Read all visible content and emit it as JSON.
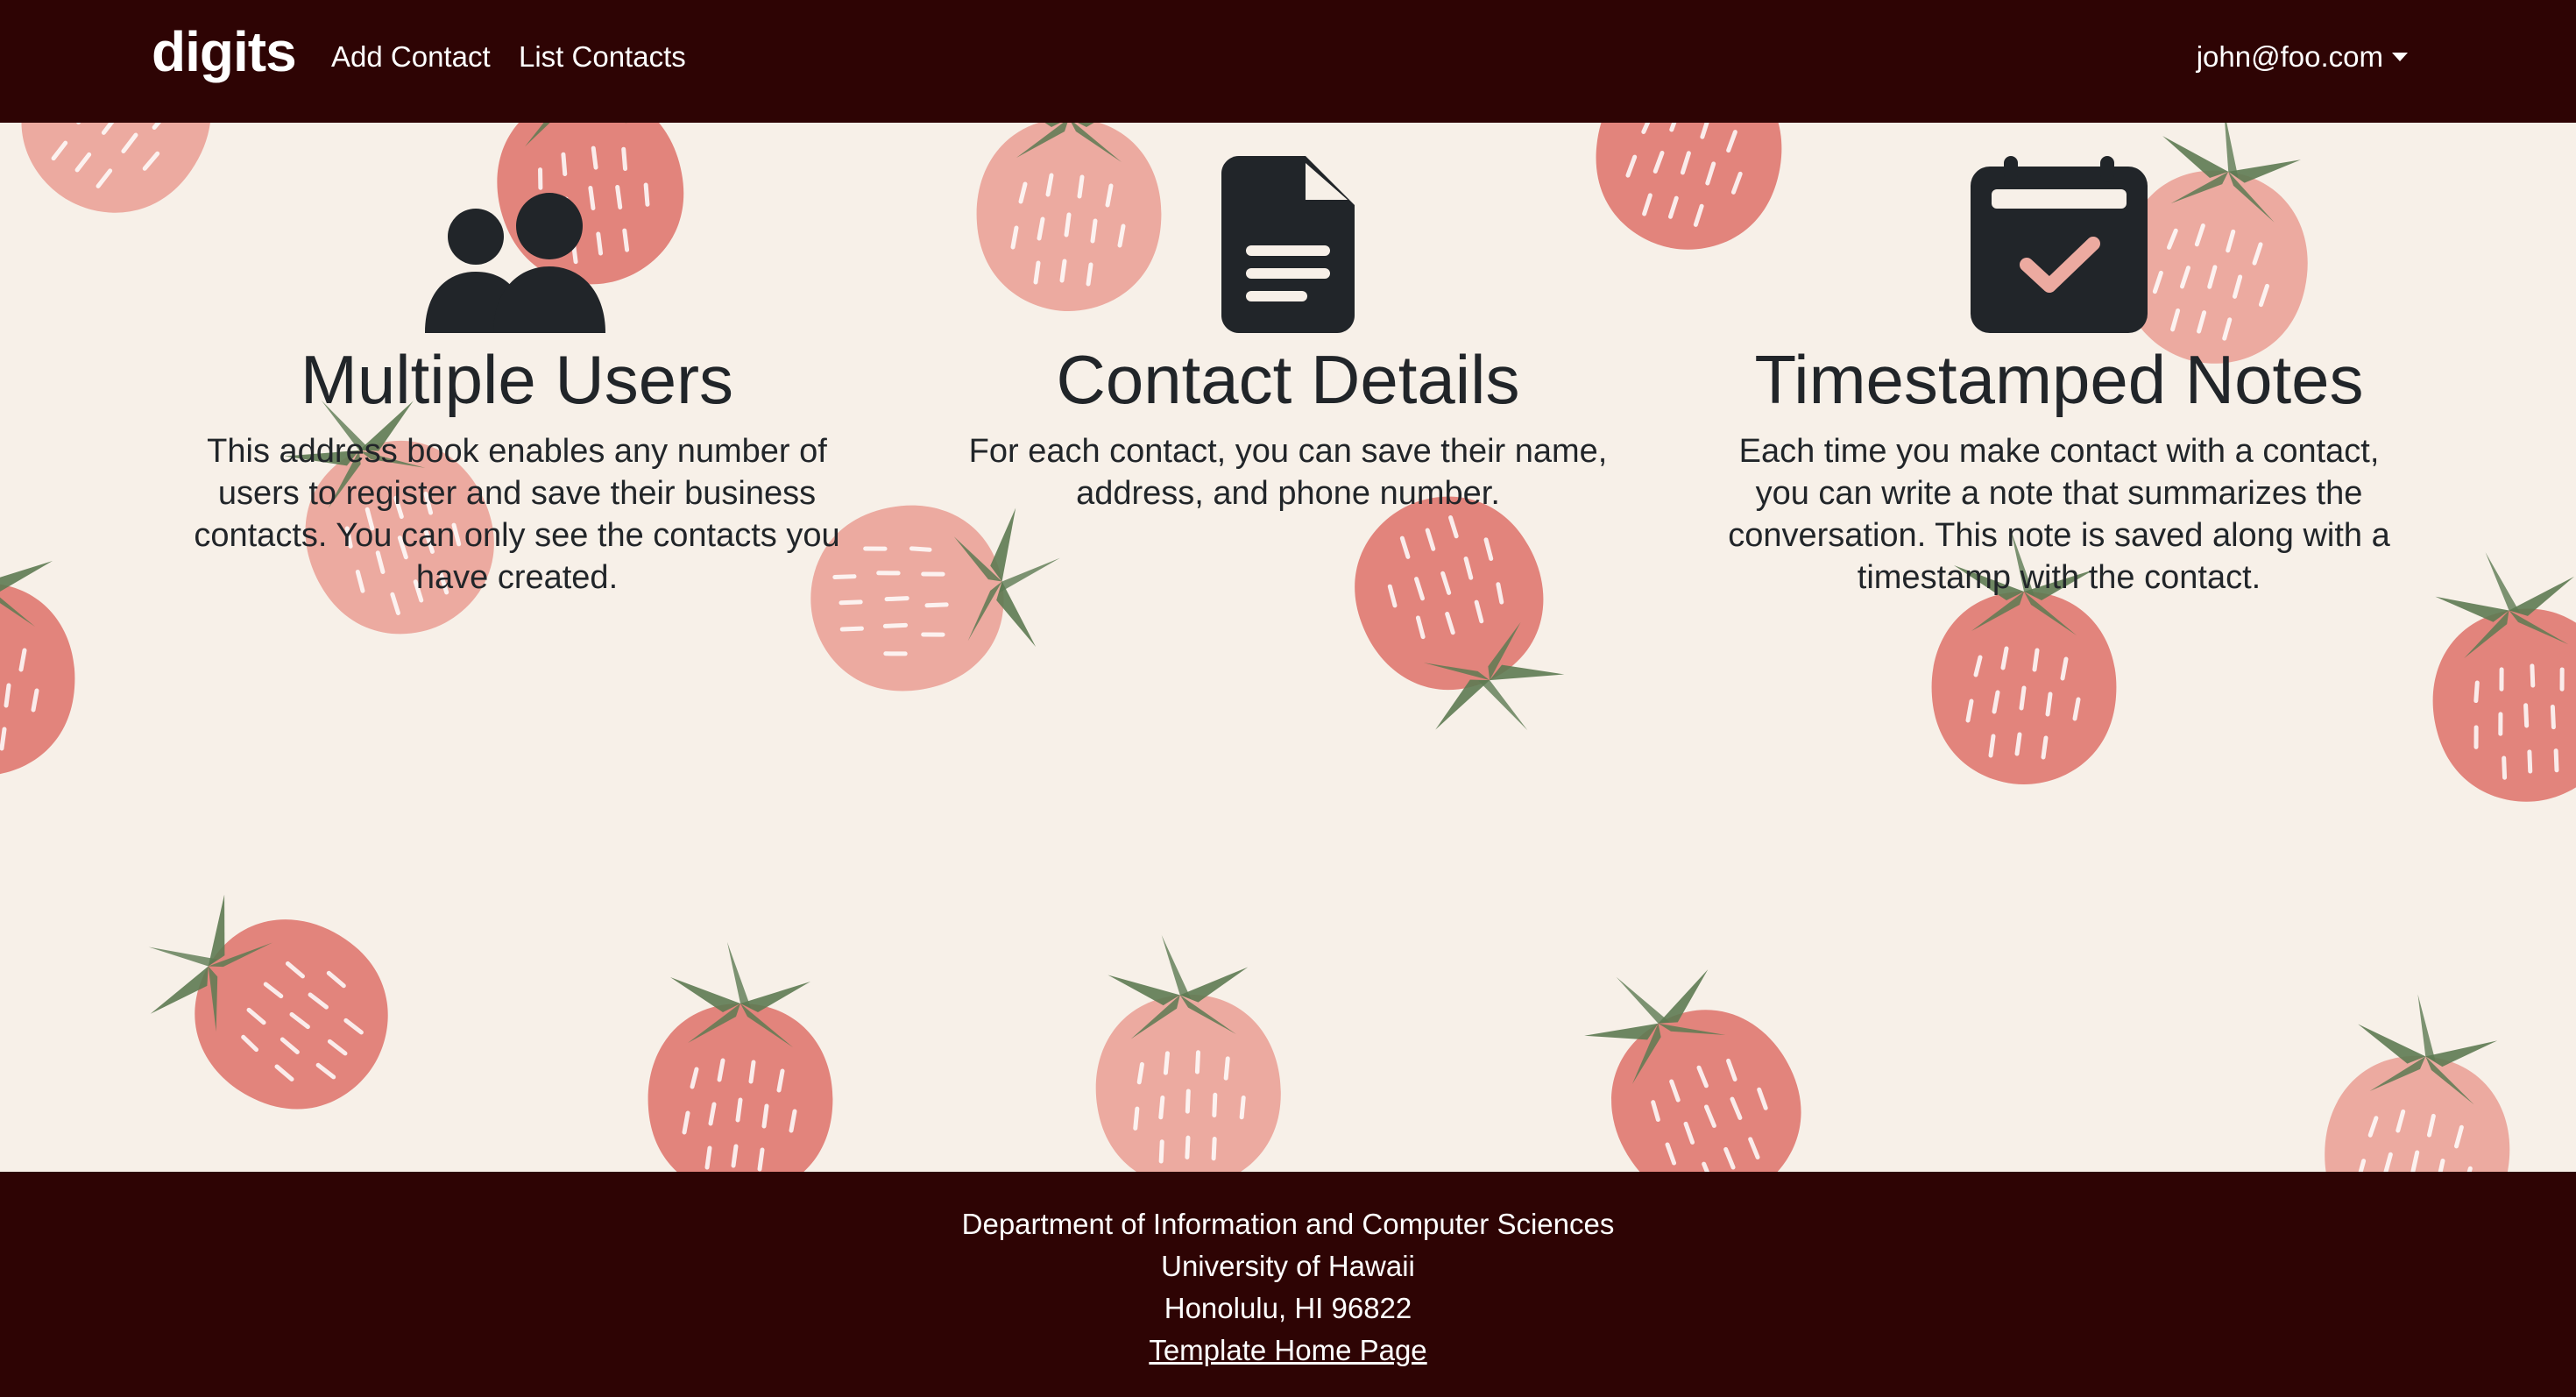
{
  "nav": {
    "brand": "digits",
    "links": [
      {
        "label": "Add Contact"
      },
      {
        "label": "List Contacts"
      }
    ],
    "user": "john@foo.com"
  },
  "features": [
    {
      "icon": "users-icon",
      "title": "Multiple Users",
      "text": "This address book enables any number of users to register and save their business contacts. You can only see the contacts you have created."
    },
    {
      "icon": "file-icon",
      "title": "Contact Details",
      "text": "For each contact, you can save their name, address, and phone number."
    },
    {
      "icon": "calendar-check-icon",
      "title": "Timestamped Notes",
      "text": "Each time you make contact with a contact, you can write a note that summarizes the conversation. This note is saved along with a timestamp with the contact."
    }
  ],
  "footer": {
    "lines": [
      "Department of Information and Computer Sciences",
      "University of Hawaii",
      "Honolulu, HI 96822"
    ],
    "link": "Template Home Page"
  },
  "colors": {
    "navbar_bg": "#2e0404",
    "page_bg": "#f7f0e8",
    "strawberry": "#e2847c",
    "strawberry_light": "#ecaaa0",
    "leaf": "#5d7a52",
    "icon": "#212529"
  }
}
